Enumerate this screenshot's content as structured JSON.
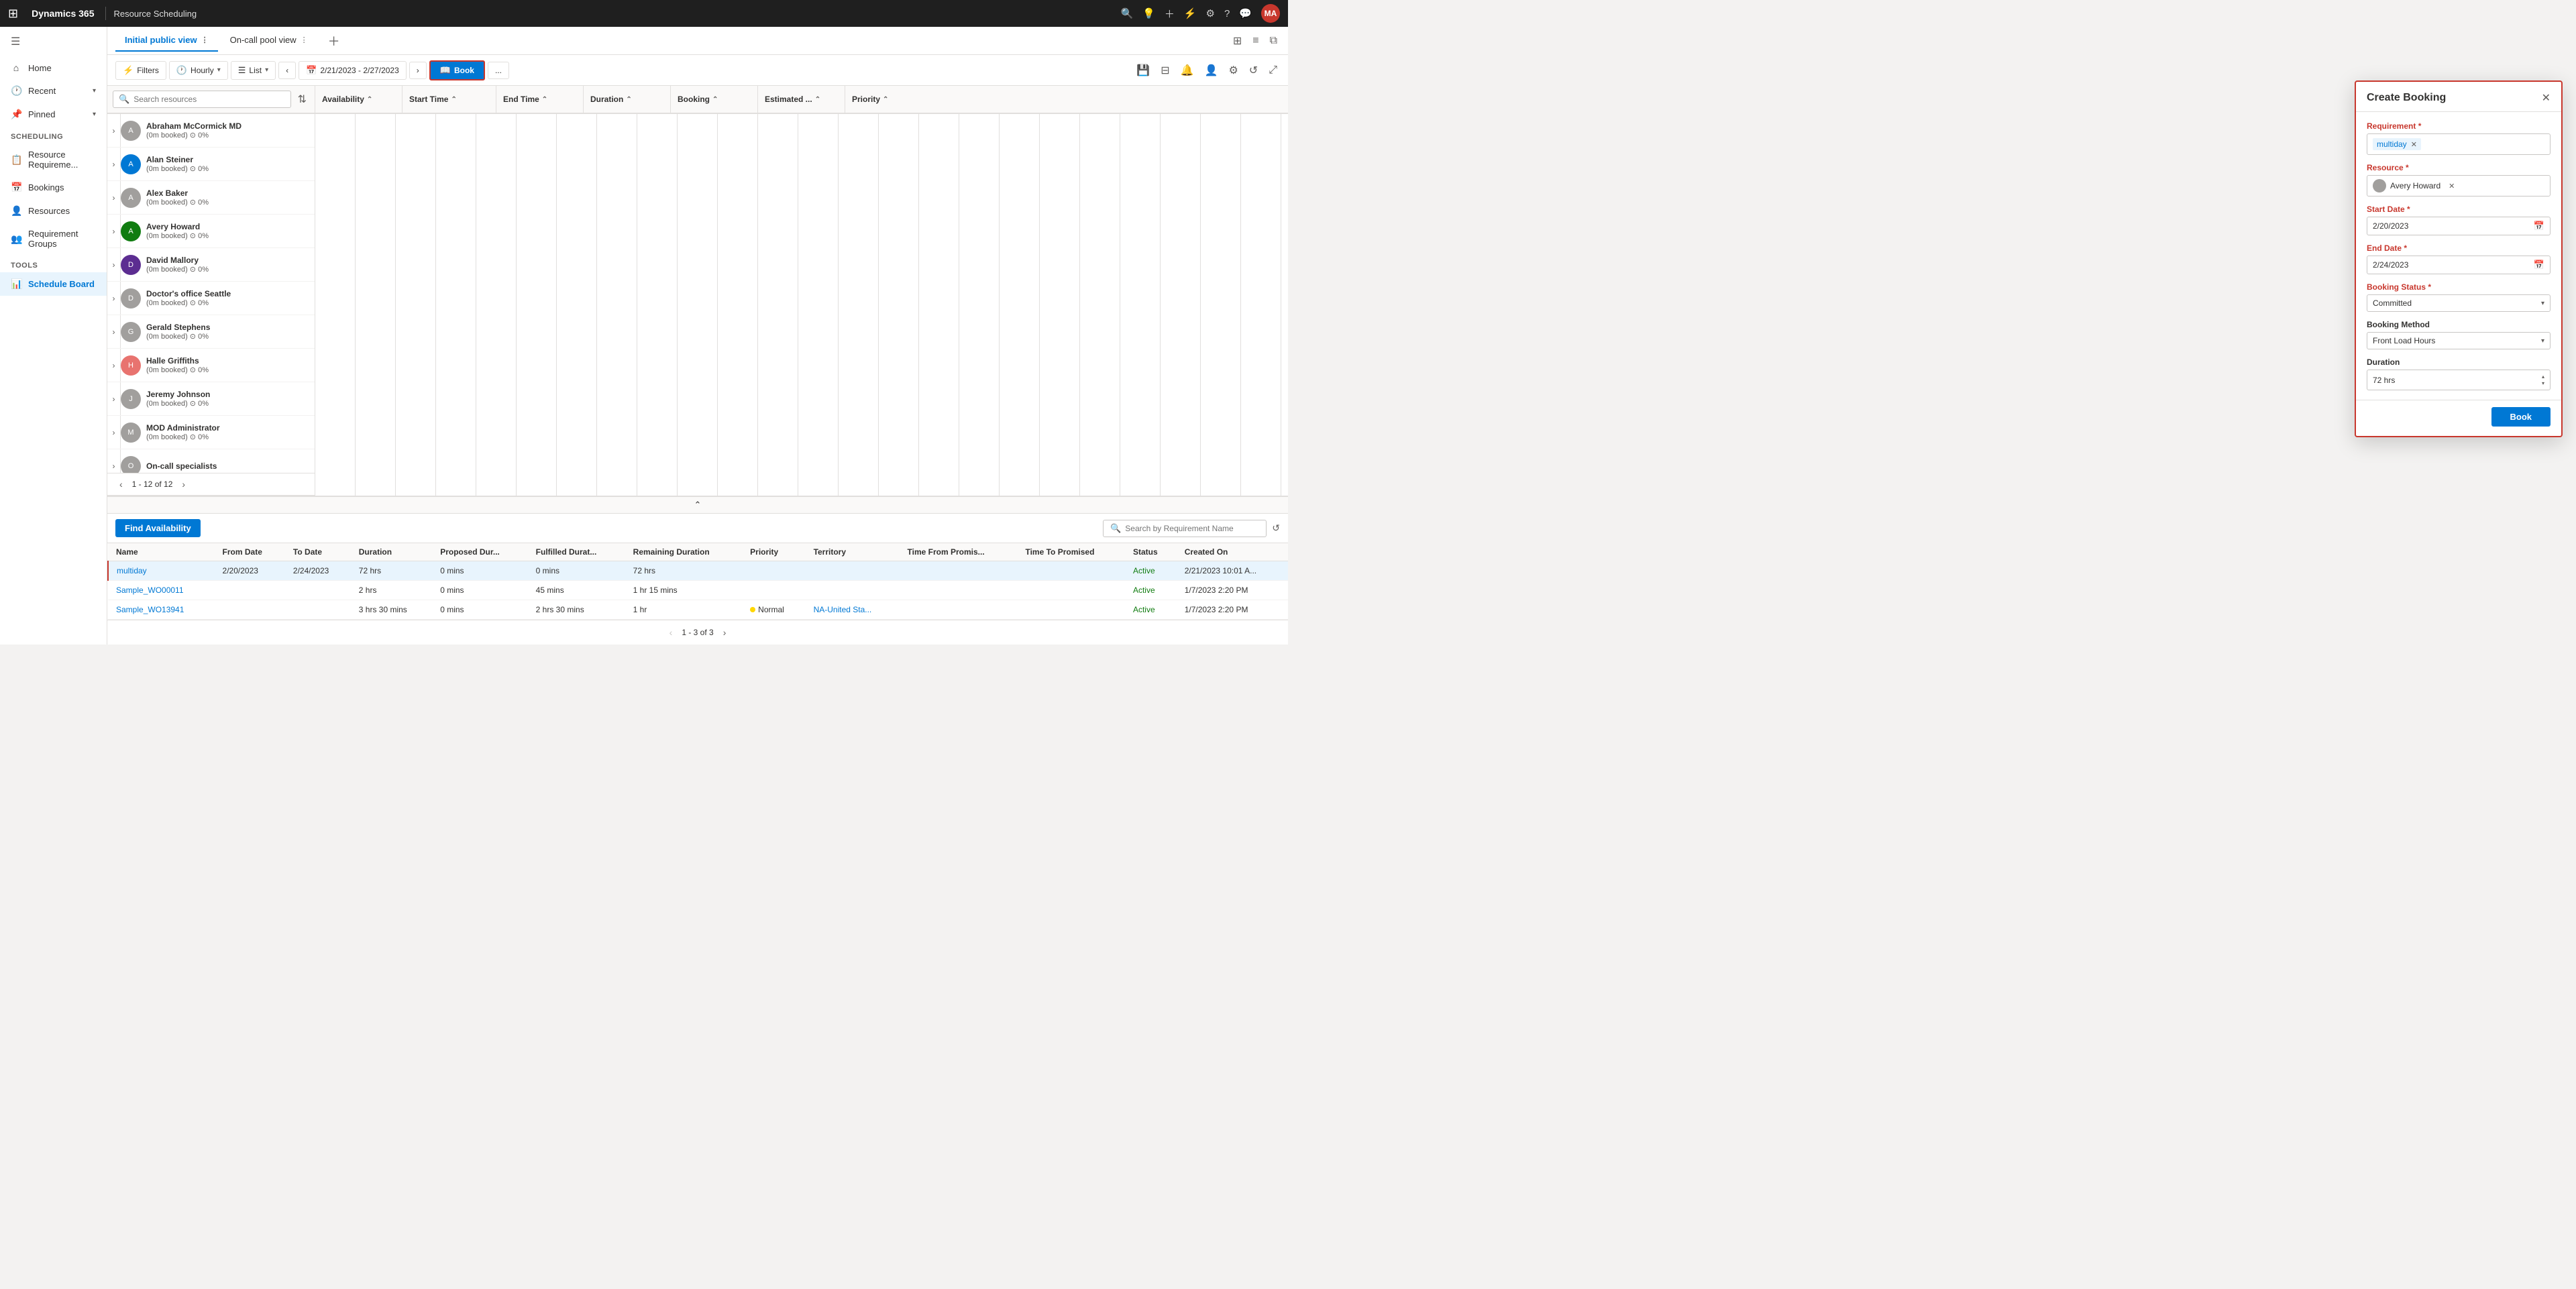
{
  "app": {
    "brand": "Dynamics 365",
    "module": "Resource Scheduling",
    "avatar_initials": "MA"
  },
  "sidebar": {
    "items": [
      {
        "label": "Home",
        "icon": "⌂"
      },
      {
        "label": "Recent",
        "icon": "🕐",
        "expandable": true
      },
      {
        "label": "Pinned",
        "icon": "📌",
        "expandable": true
      }
    ],
    "scheduling_section": "Scheduling",
    "scheduling_items": [
      {
        "label": "Resource Requireme...",
        "icon": "📋"
      },
      {
        "label": "Bookings",
        "icon": "📅"
      },
      {
        "label": "Resources",
        "icon": "👤"
      },
      {
        "label": "Requirement Groups",
        "icon": "👥"
      }
    ],
    "tools_section": "Tools",
    "tools_items": [
      {
        "label": "Schedule Board",
        "icon": "📊",
        "active": true
      }
    ]
  },
  "tabs": [
    {
      "label": "Initial public view",
      "active": true
    },
    {
      "label": "On-call pool view"
    }
  ],
  "toolbar": {
    "filters_label": "Filters",
    "hourly_label": "Hourly",
    "list_label": "List",
    "date_range": "2/21/2023 - 2/27/2023",
    "book_label": "Book",
    "more_options": "..."
  },
  "search": {
    "placeholder": "Search resources"
  },
  "column_headers": [
    {
      "label": "Availability"
    },
    {
      "label": "Start Time"
    },
    {
      "label": "End Time"
    },
    {
      "label": "Duration"
    },
    {
      "label": "Booking"
    },
    {
      "label": "Estimated ..."
    },
    {
      "label": "Priority"
    }
  ],
  "resources": [
    {
      "name": "Abraham McCormick MD",
      "meta": "(0m booked) ⊙ 0%",
      "color": "#a19f9d"
    },
    {
      "name": "Alan Steiner",
      "meta": "(0m booked) ⊙ 0%",
      "color": "#0078d4"
    },
    {
      "name": "Alex Baker",
      "meta": "(0m booked) ⊙ 0%",
      "color": "#a19f9d"
    },
    {
      "name": "Avery Howard",
      "meta": "(0m booked) ⊙ 0%",
      "color": "#107c10"
    },
    {
      "name": "David Mallory",
      "meta": "(0m booked) ⊙ 0%",
      "color": "#5c2d91"
    },
    {
      "name": "Doctor's office Seattle",
      "meta": "(0m booked) ⊙ 0%",
      "color": "#a19f9d"
    },
    {
      "name": "Gerald Stephens",
      "meta": "(0m booked) ⊙ 0%",
      "color": "#a19f9d"
    },
    {
      "name": "Halle Griffiths",
      "meta": "(0m booked) ⊙ 0%",
      "color": "#e8736f"
    },
    {
      "name": "Jeremy Johnson",
      "meta": "(0m booked) ⊙ 0%",
      "color": "#a19f9d"
    },
    {
      "name": "MOD Administrator",
      "meta": "(0m booked) ⊙ 0%",
      "color": "#a19f9d"
    },
    {
      "name": "On-call specialists",
      "meta": "",
      "color": "#a19f9d"
    }
  ],
  "resource_pagination": {
    "text": "1 - 12 of 12"
  },
  "requirement_section": {
    "find_availability_label": "Find Availability",
    "search_placeholder": "Search by Requirement Name",
    "columns": [
      "Name",
      "From Date",
      "To Date",
      "Duration",
      "Proposed Dur...",
      "Fulfilled Durat...",
      "Remaining Duration",
      "Priority",
      "Territory",
      "Time From Promis...",
      "Time To Promised",
      "Status",
      "Created On"
    ],
    "rows": [
      {
        "name": "multiday",
        "from_date": "2/20/2023",
        "to_date": "2/24/2023",
        "duration": "72 hrs",
        "proposed_dur": "0 mins",
        "fulfilled_dur": "0 mins",
        "remaining": "72 hrs",
        "priority": "",
        "territory": "",
        "time_from": "",
        "time_to": "",
        "status": "Active",
        "created_on": "2/21/2023 10:01 A...",
        "selected": true
      },
      {
        "name": "Sample_WO00011",
        "from_date": "",
        "to_date": "",
        "duration": "2 hrs",
        "proposed_dur": "0 mins",
        "fulfilled_dur": "45 mins",
        "remaining": "1 hr 15 mins",
        "priority": "",
        "territory": "",
        "time_from": "",
        "time_to": "",
        "status": "Active",
        "created_on": "1/7/2023 2:20 PM",
        "selected": false
      },
      {
        "name": "Sample_WO13941",
        "from_date": "",
        "to_date": "",
        "duration": "3 hrs 30 mins",
        "proposed_dur": "0 mins",
        "fulfilled_dur": "2 hrs 30 mins",
        "remaining": "1 hr",
        "priority": "Normal",
        "territory": "NA-United Sta...",
        "time_from": "",
        "time_to": "",
        "status": "Active",
        "created_on": "1/7/2023 2:20 PM",
        "selected": false
      }
    ],
    "pagination": "1 - 3 of 3"
  },
  "create_booking": {
    "title": "Create Booking",
    "requirement_label": "Requirement",
    "requirement_value": "multiday",
    "resource_label": "Resource",
    "resource_value": "Avery Howard",
    "start_date_label": "Start Date",
    "start_date_value": "2/20/2023",
    "end_date_label": "End Date",
    "end_date_value": "2/24/2023",
    "booking_status_label": "Booking Status",
    "booking_status_value": "Committed",
    "booking_method_label": "Booking Method",
    "booking_method_value": "Front Load Hours",
    "duration_label": "Duration",
    "duration_value": "72 hrs",
    "book_btn_label": "Book"
  }
}
